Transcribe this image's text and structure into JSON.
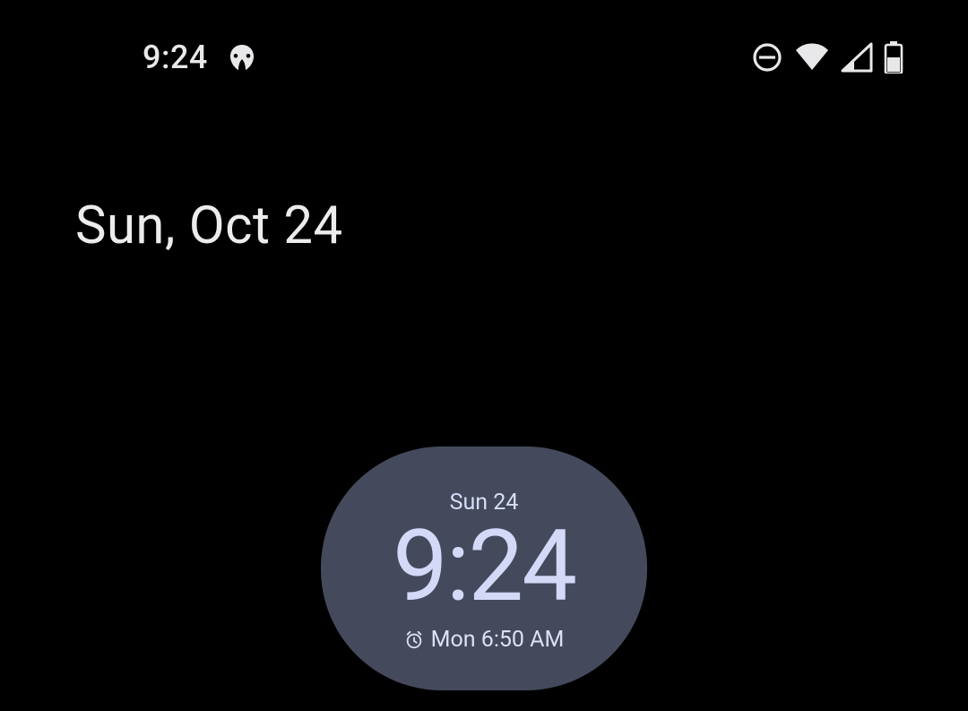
{
  "statusbar": {
    "time": "9:24",
    "icons": {
      "app": "malwarebytes-icon",
      "dnd": "do-not-disturb-icon",
      "wifi": "wifi-icon",
      "signal": "cellular-signal-icon",
      "battery": "battery-icon"
    }
  },
  "header": {
    "date": "Sun, Oct 24"
  },
  "clock_widget": {
    "date": "Sun 24",
    "time": "9:24",
    "alarm": "Mon 6:50 AM"
  }
}
